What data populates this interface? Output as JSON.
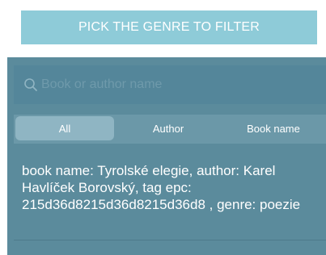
{
  "genre_button": {
    "label": "PICK THE GENRE TO FILTER"
  },
  "search": {
    "placeholder": "Book or author name",
    "value": ""
  },
  "tabs": [
    {
      "label": "All",
      "active": true
    },
    {
      "label": "Author",
      "active": false
    },
    {
      "label": "Book name",
      "active": false
    }
  ],
  "results": [
    {
      "text": "book name: Tyrolské elegie, author: Karel Havlíček Borovský, tag epc: 215d36d8215d36d8215d36d8 , genre: poezie"
    }
  ],
  "colors": {
    "genre_button_bg": "#8ecbd8",
    "panel_bg": "#5b8b9c",
    "active_tab_bg": "#8fb5c3"
  },
  "icons": {
    "search": "search-icon"
  }
}
